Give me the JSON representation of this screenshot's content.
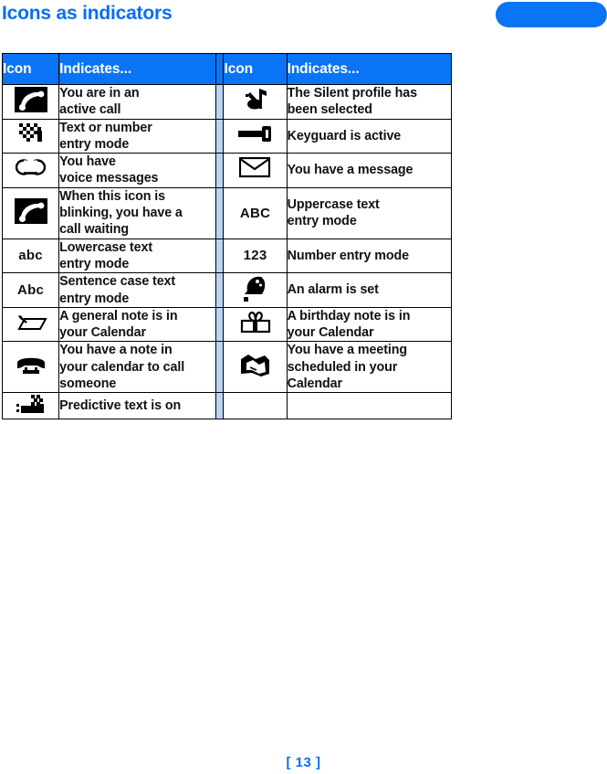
{
  "page": {
    "title": "Icons as indicators",
    "footer_page_number": "[ 13 ]",
    "accent_color": "#0a74f7",
    "spacer_color": "#b9d4f5",
    "title_color": "#0a6ef5"
  },
  "table": {
    "headers": {
      "icon_left": "Icon",
      "indicates_left": "Indicates...",
      "icon_right": "Icon",
      "indicates_right": "Indicates..."
    },
    "rows": [
      {
        "left": {
          "icon": "active-call-icon",
          "icon_text": "",
          "text": "You are in an\nactive call"
        },
        "right": {
          "icon": "silent-profile-icon",
          "icon_text": "",
          "text": "The Silent profile has\nbeen selected"
        }
      },
      {
        "left": {
          "icon": "text-entry-icon",
          "icon_text": "",
          "text": "Text or number\nentry mode"
        },
        "right": {
          "icon": "keyguard-icon",
          "icon_text": "",
          "text": "Keyguard is active"
        }
      },
      {
        "left": {
          "icon": "voice-messages-icon",
          "icon_text": "",
          "text": "You have\nvoice messages"
        },
        "right": {
          "icon": "envelope-icon",
          "icon_text": "",
          "text": "You have a message"
        }
      },
      {
        "left": {
          "icon": "call-waiting-icon",
          "icon_text": "",
          "text": "When this icon is\nblinking, you have a\ncall waiting"
        },
        "right": {
          "icon": "abc-text-label",
          "icon_text": "ABC",
          "text": "Uppercase text\nentry mode"
        }
      },
      {
        "left": {
          "icon": "abc-lowercase-label",
          "icon_text": "abc",
          "text": "Lowercase text\nentry mode"
        },
        "right": {
          "icon": "number-label",
          "icon_text": "123",
          "text": "Number entry mode"
        }
      },
      {
        "left": {
          "icon": "abc-sentence-label",
          "icon_text": "Abc",
          "text": "Sentence case text\nentry mode"
        },
        "right": {
          "icon": "alarm-bell-icon",
          "icon_text": "",
          "text": "An alarm is set"
        }
      },
      {
        "left": {
          "icon": "general-note-icon",
          "icon_text": "",
          "text": "A general note is in\nyour Calendar"
        },
        "right": {
          "icon": "gift-birthday-icon",
          "icon_text": "",
          "text": "A birthday note is in\nyour Calendar"
        }
      },
      {
        "left": {
          "icon": "telephone-note-icon",
          "icon_text": "",
          "text": "You have a note in\nyour calendar to call\nsomeone"
        },
        "right": {
          "icon": "meeting-handshake-icon",
          "icon_text": "",
          "text": "You have a meeting\nscheduled in your\nCalendar"
        }
      },
      {
        "left": {
          "icon": "predictive-text-icon",
          "icon_text": "",
          "text": "Predictive text is on"
        },
        "right": {
          "icon": "",
          "icon_text": "",
          "text": ""
        }
      }
    ]
  }
}
